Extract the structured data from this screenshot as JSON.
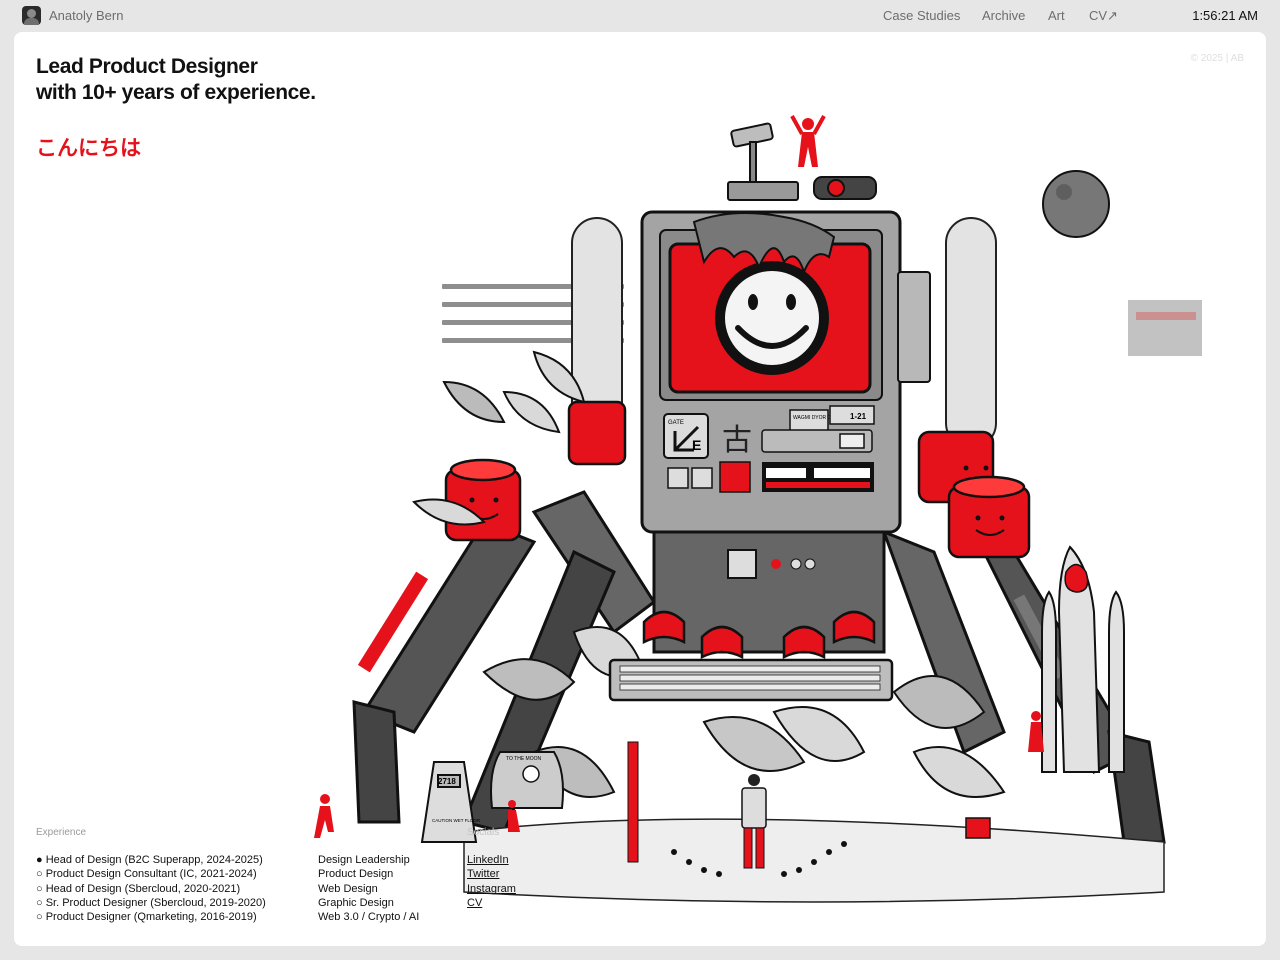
{
  "topbar": {
    "owner_name": "Anatoly Bern",
    "nav": [
      "Case Studies",
      "Archive",
      "Art",
      "CV↗"
    ],
    "clock": "1:56:21 AM"
  },
  "hero": {
    "line1": "Lead Product Designer",
    "line2": "with 10+ years of experience.",
    "greeting": "こんにちは",
    "copyright": "© 2025 | AB"
  },
  "illustration": {
    "gate_label": "GATE",
    "gate_letter": "E",
    "kanji": "古",
    "sign_text": "WAGMI DYOR GM",
    "gate_number": "1-21",
    "caution_number": "2718",
    "caution_text": "CAUTION WET FLOOR",
    "pod_label": "TO THE MOON"
  },
  "experience": {
    "label": "Experience",
    "items": [
      "● Head of Design (B2C Superapp, 2024-2025)",
      "○ Product Design Consultant (IC, 2021-2024)",
      "○ Head of Design (Sbercloud, 2020-2021)",
      "○ Sr. Product Designer (Sbercloud, 2019-2020)",
      "○ Product Designer (Qmarketing, 2016-2019)"
    ]
  },
  "skills": {
    "items": [
      "Design Leadership",
      "Product Design",
      "Web Design",
      "Graphic Design",
      "Web 3.0 / Crypto / AI"
    ]
  },
  "socials": {
    "label": "Socials",
    "links": [
      "LinkedIn",
      "Twitter",
      "Instagram",
      "CV"
    ]
  },
  "colors": {
    "accent": "#e5121b",
    "text": "#111111",
    "muted": "#6d6d6d",
    "background": "#e6e6e7"
  }
}
